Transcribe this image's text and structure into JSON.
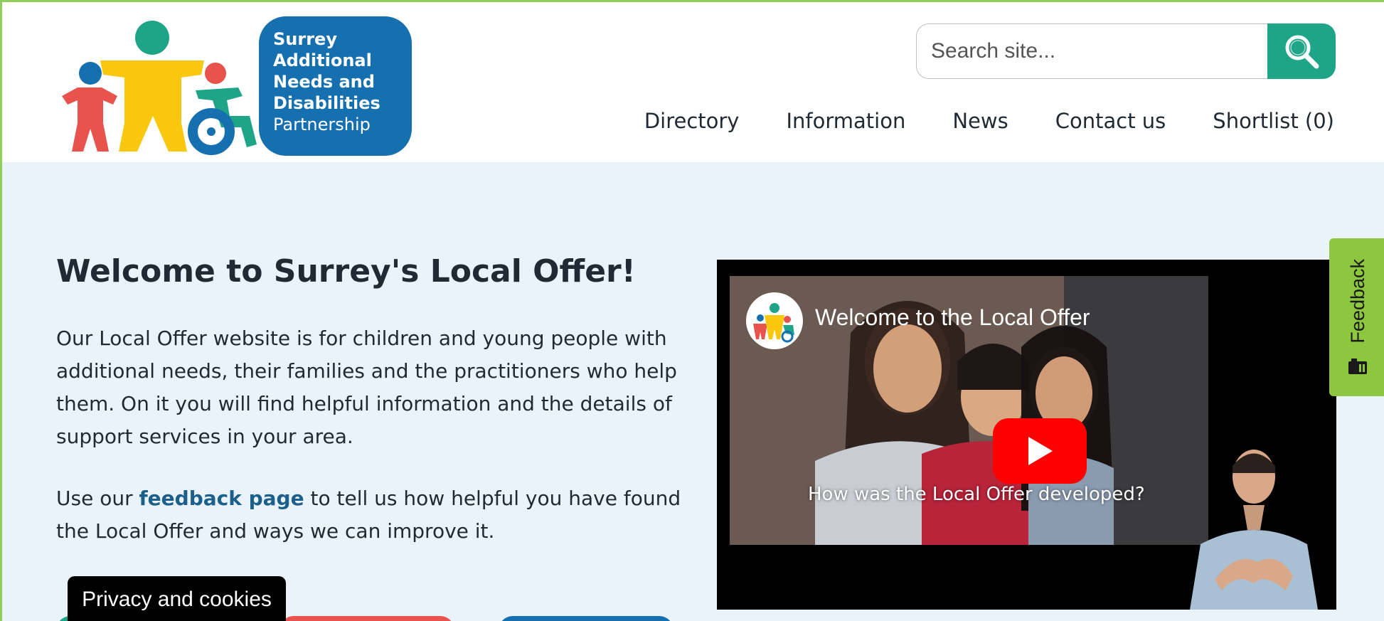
{
  "logo": {
    "text_line1": "Surrey",
    "text_line2": "Additional",
    "text_line3": "Needs and",
    "text_line4": "Disabilities",
    "text_line5": "Partnership"
  },
  "search": {
    "placeholder": "Search site...",
    "icon": "search-icon"
  },
  "nav": {
    "items": [
      {
        "label": "Directory"
      },
      {
        "label": "Information"
      },
      {
        "label": "News"
      },
      {
        "label": "Contact us"
      },
      {
        "label": "Shortlist (0)"
      }
    ]
  },
  "main": {
    "title": "Welcome to Surrey's Local Offer!",
    "intro": "Our Local Offer website is for children and young people with additional needs, their families and the practitioners who help them. On it you will find helpful information and the details of support services in your area.",
    "feedback_before": "Use our ",
    "feedback_link": "feedback page",
    "feedback_after": " to tell us how helpful you have found the Local Offer and ways we can improve it."
  },
  "video": {
    "title": "Welcome to the Local Offer",
    "caption": "How was the Local Offer developed?"
  },
  "privacy": {
    "label": "Privacy and cookies"
  },
  "feedback_tab": {
    "label": "Feedback"
  },
  "colors": {
    "accent_green": "#1ea487",
    "feedback_green": "#8dc63f",
    "logo_blue": "#1670b0",
    "link_blue": "#1b5f8a",
    "main_bg": "#eaf3f9",
    "youtube_red": "#ff0000"
  }
}
